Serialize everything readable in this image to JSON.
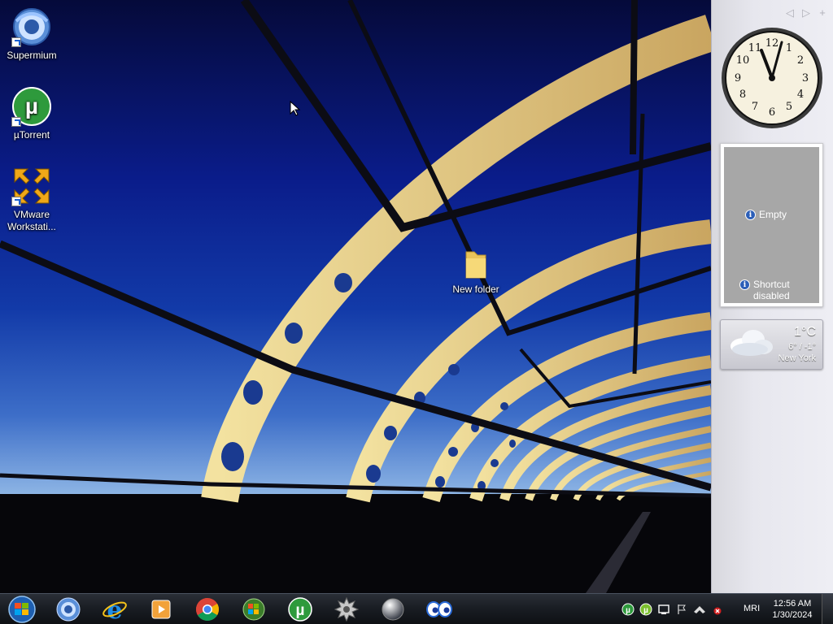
{
  "desktop": {
    "icons": [
      {
        "label": "Supermium"
      },
      {
        "label": "µTorrent"
      },
      {
        "label": "VMware Workstati..."
      },
      {
        "label": "New folder"
      }
    ]
  },
  "sidebar": {
    "slideshow": {
      "empty_text": "Empty",
      "shortcut_text": "Shortcut disabled"
    },
    "weather": {
      "temp": "1°C",
      "range": "6° / -1°",
      "city": "New York"
    }
  },
  "taskbar": {
    "apps": [
      "start-orb",
      "supermium-icon",
      "internet-explorer-icon",
      "media-player-icon",
      "chrome-icon",
      "windows-live-icon",
      "utorrent-icon",
      "gear-app-icon",
      "sphere-app-icon",
      "eyes-app-icon"
    ],
    "language": "MRI",
    "time": "12:56 AM",
    "date": "1/30/2024"
  },
  "colors": {
    "taskbar_bg": "#1a1e24",
    "sidebar_bg": "#e7e7ee",
    "slideshow_bg": "#a7a7a7",
    "info_icon": "#2c5fb8",
    "utorrent_green": "#2e9a3c"
  }
}
